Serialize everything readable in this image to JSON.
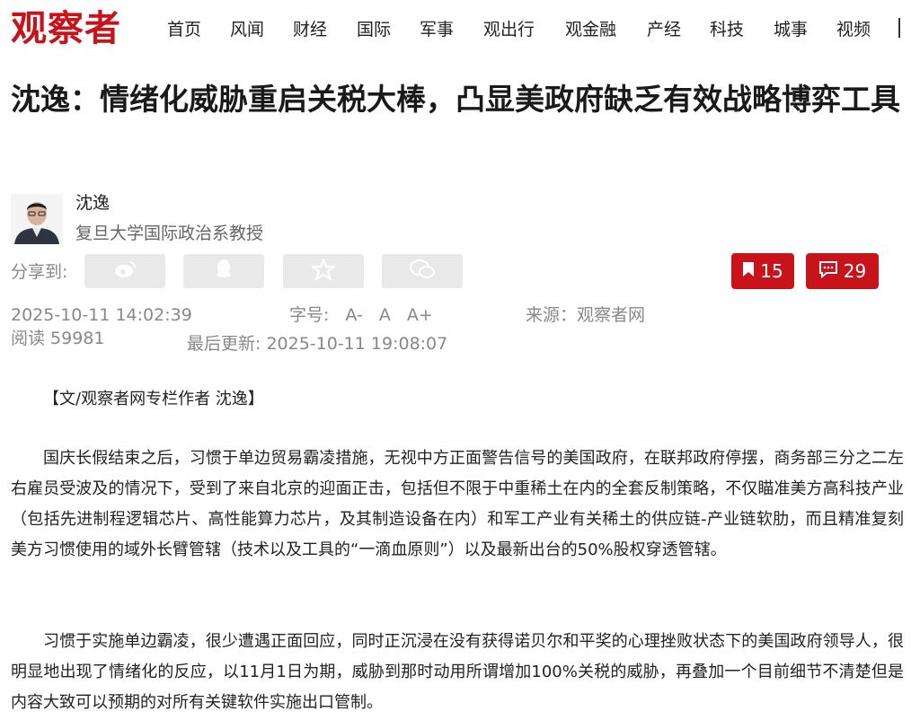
{
  "site": {
    "logo_text": "观察者",
    "brand_color": "#c8131b"
  },
  "nav": {
    "items": [
      {
        "label": "首页"
      },
      {
        "label": "风闻"
      },
      {
        "label": "财经"
      },
      {
        "label": "国际"
      },
      {
        "label": "军事"
      },
      {
        "label": "观出行"
      },
      {
        "label": "观金融"
      },
      {
        "label": "产经"
      },
      {
        "label": "科技"
      },
      {
        "label": "城事"
      },
      {
        "label": "视频"
      }
    ]
  },
  "article": {
    "title": "沈逸：情绪化威胁重启关税大棒，凸显美政府缺乏有效战略博弈工具",
    "author": {
      "name": "沈逸",
      "description": "复旦大学国际政治系教授"
    },
    "share": {
      "label": "分享到:",
      "buttons": [
        {
          "icon": "weibo-icon"
        },
        {
          "icon": "qq-icon"
        },
        {
          "icon": "qzone-star-icon"
        },
        {
          "icon": "wechat-icon"
        }
      ]
    },
    "bookmark_count": "15",
    "comment_count": "29",
    "meta": {
      "publish_time": "2025-10-11 14:02:39",
      "font_size_label": "字号:",
      "font_size_small": "A-",
      "font_size_normal": "A",
      "font_size_large": "A+",
      "source": "来源：观察者网",
      "read_count": "阅读 59981",
      "last_updated": "最后更新: 2025-10-11 19:08:07"
    },
    "byline": "【文/观察者网专栏作者 沈逸】",
    "paragraphs": [
      "国庆长假结束之后，习惯于单边贸易霸凌措施，无视中方正面警告信号的美国政府，在联邦政府停摆，商务部三分之二左右雇员受波及的情况下，受到了来自北京的迎面正击，包括但不限于中重稀土在内的全套反制策略，不仅瞄准美方高科技产业（包括先进制程逻辑芯片、高性能算力芯片，及其制造设备在内）和军工产业有关稀土的供应链-产业链软肋，而且精准复刻美方习惯使用的域外长臂管辖（技术以及工具的“一滴血原则”）以及最新出台的50%股权穿透管辖。",
      "习惯于实施单边霸凌，很少遭遇正面回应，同时正沉浸在没有获得诺贝尔和平奖的心理挫败状态下的美国政府领导人，很明显地出现了情绪化的反应，以11月1日为期，威胁到那时动用所谓增加100%关税的威胁，再叠加一个目前细节不清楚但是内容大致可以预期的对所有关键软件实施出口管制。"
    ]
  }
}
